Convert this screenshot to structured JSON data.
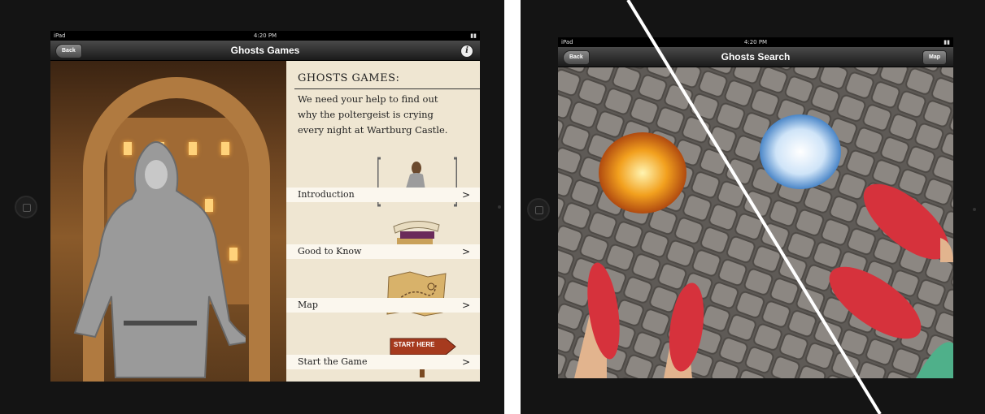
{
  "left_screen": {
    "status": {
      "carrier": "iPad",
      "time": "4:20 PM"
    },
    "navbar": {
      "back_label": "Back",
      "title": "Ghosts Games",
      "info_label": "i"
    },
    "panel": {
      "heading": "GHOSTS GAMES:",
      "intro_lines": [
        "We need your help to find out",
        "why the poltergeist is crying",
        "every night at Wartburg Castle."
      ],
      "menu": [
        {
          "label": "Introduction",
          "chevron": ">",
          "icon": "seated-woman-picture-icon"
        },
        {
          "label": "Good to Know",
          "chevron": ">",
          "icon": "book-stack-icon"
        },
        {
          "label": "Map",
          "chevron": ">",
          "icon": "treasure-map-icon"
        },
        {
          "label": "Start the Game",
          "chevron": ">",
          "icon": "start-here-signpost-icon"
        }
      ],
      "signpost_text": "START HERE"
    }
  },
  "right_screen": {
    "status": {
      "carrier": "iPad",
      "time": "4:20 PM"
    },
    "navbar": {
      "back_label": "Back",
      "title": "Ghosts Search",
      "map_label": "Map"
    }
  },
  "colors": {
    "navbar": "#2a2a2a",
    "panel_bg": "#efe6d2",
    "fire_orb": "#f2a01e",
    "ice_orb": "#7fb4e6",
    "shoe_red": "#d6323c"
  }
}
